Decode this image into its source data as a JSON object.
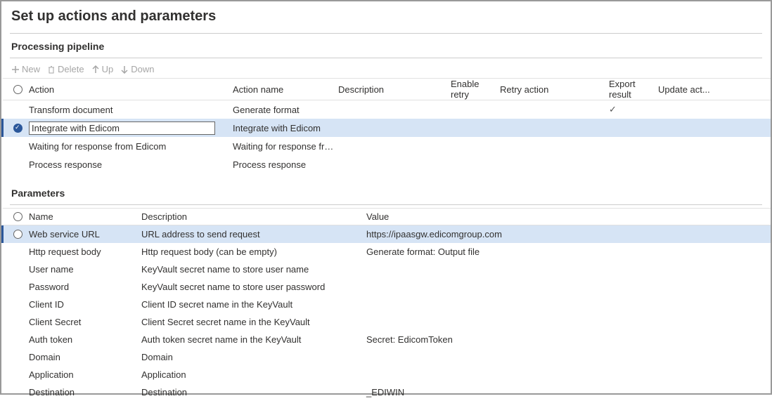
{
  "title": "Set up actions and parameters",
  "sections": {
    "pipeline": {
      "title": "Processing pipeline",
      "toolbar": {
        "new": "New",
        "delete": "Delete",
        "up": "Up",
        "down": "Down"
      },
      "headers": {
        "action": "Action",
        "action_name": "Action name",
        "description": "Description",
        "enable_retry": "Enable retry",
        "retry_action": "Retry action",
        "export_result": "Export result",
        "update_action": "Update act..."
      },
      "rows": [
        {
          "selected": false,
          "action": "Transform document",
          "action_name": "Generate format",
          "description": "",
          "enable_retry": "",
          "retry_action": "",
          "export_result": "✓",
          "update_action": ""
        },
        {
          "selected": true,
          "action": "Integrate with Edicom",
          "action_name": "Integrate with Edicom",
          "description": "",
          "enable_retry": "",
          "retry_action": "",
          "export_result": "",
          "update_action": ""
        },
        {
          "selected": false,
          "action": "Waiting for response from Edicom",
          "action_name": "Waiting for response fro...",
          "description": "",
          "enable_retry": "",
          "retry_action": "",
          "export_result": "",
          "update_action": ""
        },
        {
          "selected": false,
          "action": "Process response",
          "action_name": "Process response",
          "description": "",
          "enable_retry": "",
          "retry_action": "",
          "export_result": "",
          "update_action": ""
        }
      ]
    },
    "parameters": {
      "title": "Parameters",
      "headers": {
        "name": "Name",
        "description": "Description",
        "value": "Value"
      },
      "rows": [
        {
          "selected": true,
          "name": "Web service URL",
          "description": "URL address to send request",
          "value": "https://ipaasgw.edicomgroup.com"
        },
        {
          "selected": false,
          "name": "Http request body",
          "description": "Http request body (can be empty)",
          "value": "Generate format: Output file"
        },
        {
          "selected": false,
          "name": "User name",
          "description": "KeyVault secret name to store user name",
          "value": ""
        },
        {
          "selected": false,
          "name": "Password",
          "description": "KeyVault secret name to store user password",
          "value": ""
        },
        {
          "selected": false,
          "name": "Client ID",
          "description": "Client ID secret name in the KeyVault",
          "value": ""
        },
        {
          "selected": false,
          "name": "Client Secret",
          "description": "Client Secret secret name in the KeyVault",
          "value": ""
        },
        {
          "selected": false,
          "name": "Auth token",
          "description": "Auth token secret name in the KeyVault",
          "value": "Secret: EdicomToken"
        },
        {
          "selected": false,
          "name": "Domain",
          "description": "Domain",
          "value": ""
        },
        {
          "selected": false,
          "name": "Application",
          "description": "Application",
          "value": ""
        },
        {
          "selected": false,
          "name": "Destination",
          "description": "Destination",
          "value": "_EDIWIN"
        }
      ]
    }
  }
}
